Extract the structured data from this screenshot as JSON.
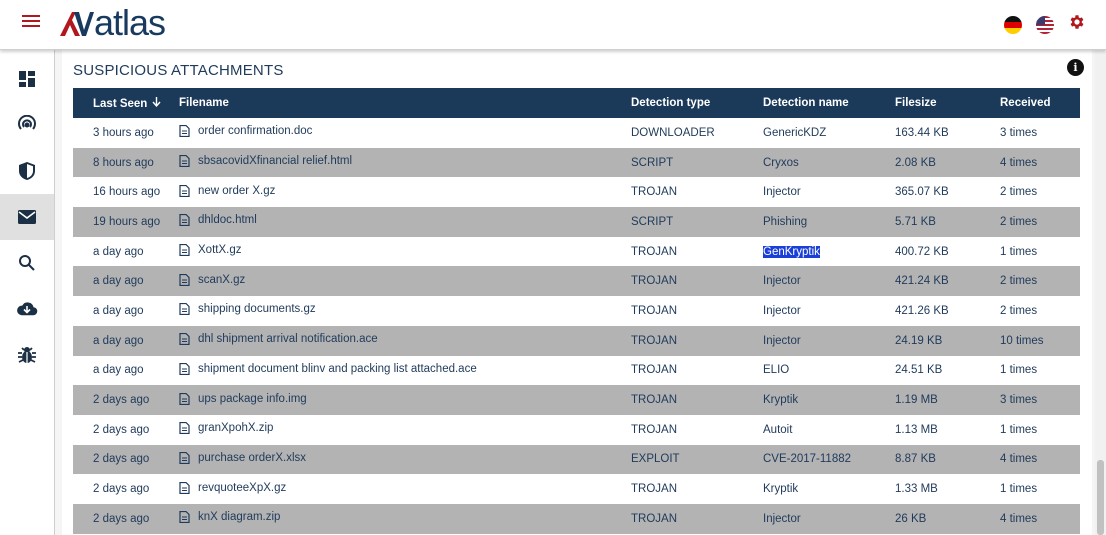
{
  "header": {
    "logo_text": "atlas",
    "colors": {
      "brand_red": "#b0181d",
      "brand_navy": "#173a5e"
    }
  },
  "sidebar": {
    "items": [
      {
        "icon": "dashboard-icon"
      },
      {
        "icon": "radar-icon"
      },
      {
        "icon": "shield-icon"
      },
      {
        "icon": "mail-icon",
        "active": true
      },
      {
        "icon": "search-icon"
      },
      {
        "icon": "cloud-download-icon"
      },
      {
        "icon": "bug-icon"
      }
    ]
  },
  "card": {
    "title": "SUSPICIOUS ATTACHMENTS"
  },
  "table": {
    "headers": {
      "last_seen": "Last Seen",
      "filename": "Filename",
      "detection_type": "Detection type",
      "detection_name": "Detection name",
      "filesize": "Filesize",
      "received": "Received"
    },
    "rows": [
      {
        "last_seen": "3 hours ago",
        "filename": "order confirmation.doc",
        "type": "DOWNLOADER",
        "name": "GenericKDZ",
        "size": "163.44 KB",
        "received": "3 times"
      },
      {
        "last_seen": "8 hours ago",
        "filename": "sbsacovidXfinancial relief.html",
        "type": "SCRIPT",
        "name": "Cryxos",
        "size": "2.08 KB",
        "received": "4 times"
      },
      {
        "last_seen": "16 hours ago",
        "filename": "new order X.gz",
        "type": "TROJAN",
        "name": "Injector",
        "size": "365.07 KB",
        "received": "2 times"
      },
      {
        "last_seen": "19 hours ago",
        "filename": "dhldoc.html",
        "type": "SCRIPT",
        "name": "Phishing",
        "size": "5.71 KB",
        "received": "2 times"
      },
      {
        "last_seen": "a day ago",
        "filename": "XottX.gz",
        "type": "TROJAN",
        "name": "GenKryptik",
        "size": "400.72 KB",
        "received": "1 times",
        "highlight": true
      },
      {
        "last_seen": "a day ago",
        "filename": "scanX.gz",
        "type": "TROJAN",
        "name": "Injector",
        "size": "421.24 KB",
        "received": "2 times"
      },
      {
        "last_seen": "a day ago",
        "filename": "shipping documents.gz",
        "type": "TROJAN",
        "name": "Injector",
        "size": "421.26 KB",
        "received": "2 times"
      },
      {
        "last_seen": "a day ago",
        "filename": "dhl shipment arrival notification.ace",
        "type": "TROJAN",
        "name": "Injector",
        "size": "24.19 KB",
        "received": "10 times"
      },
      {
        "last_seen": "a day ago",
        "filename": "shipment document blinv and packing list attached.ace",
        "type": "TROJAN",
        "name": "ELIO",
        "size": "24.51 KB",
        "received": "1 times"
      },
      {
        "last_seen": "2 days ago",
        "filename": "ups package info.img",
        "type": "TROJAN",
        "name": "Kryptik",
        "size": "1.19 MB",
        "received": "3 times"
      },
      {
        "last_seen": "2 days ago",
        "filename": "granXpohX.zip",
        "type": "TROJAN",
        "name": "Autoit",
        "size": "1.13 MB",
        "received": "1 times"
      },
      {
        "last_seen": "2 days ago",
        "filename": "purchase orderX.xlsx",
        "type": "EXPLOIT",
        "name": "CVE-2017-11882",
        "size": "8.87 KB",
        "received": "4 times"
      },
      {
        "last_seen": "2 days ago",
        "filename": "revquoteeXpX.gz",
        "type": "TROJAN",
        "name": "Kryptik",
        "size": "1.33 MB",
        "received": "1 times"
      },
      {
        "last_seen": "2 days ago",
        "filename": "knX diagram.zip",
        "type": "TROJAN",
        "name": "Injector",
        "size": "26 KB",
        "received": "4 times"
      }
    ]
  }
}
